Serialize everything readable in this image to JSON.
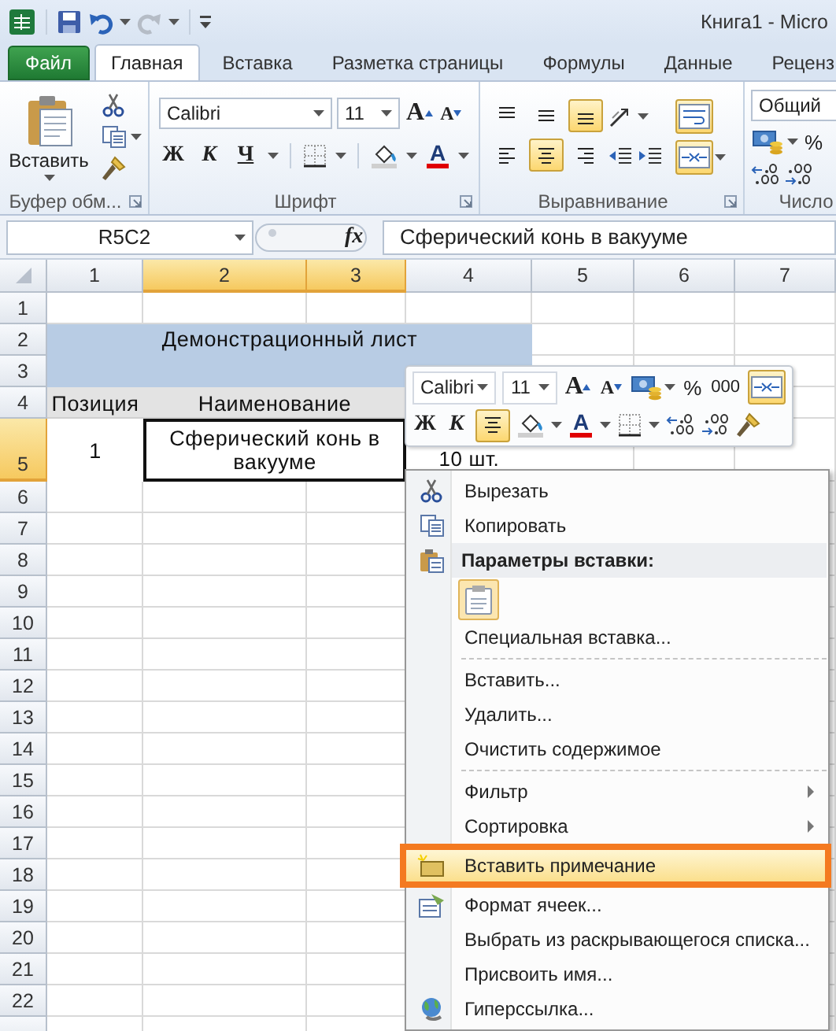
{
  "window": {
    "title": "Книга1 - Micro"
  },
  "tabs": [
    {
      "label": "Файл",
      "kind": "file",
      "selected": false
    },
    {
      "label": "Главная",
      "kind": "tab",
      "selected": true
    },
    {
      "label": "Вставка",
      "kind": "tab",
      "selected": false
    },
    {
      "label": "Разметка страницы",
      "kind": "tab",
      "selected": false
    },
    {
      "label": "Формулы",
      "kind": "tab",
      "selected": false
    },
    {
      "label": "Данные",
      "kind": "tab",
      "selected": false
    },
    {
      "label": "Реценз",
      "kind": "tab",
      "selected": false
    }
  ],
  "ribbon": {
    "clipboard": {
      "paste": "Вставить",
      "label": "Буфер обм..."
    },
    "font": {
      "name": "Calibri",
      "size": "11",
      "grow": "A",
      "shrink": "A",
      "bold": "Ж",
      "italic": "К",
      "underline": "Ч",
      "text_color_label": "A",
      "label": "Шрифт"
    },
    "alignment": {
      "vertical": [
        {
          "selected": false
        },
        {
          "selected": false
        },
        {
          "selected": true
        }
      ],
      "horizontal": [
        {
          "selected": false
        },
        {
          "selected": true
        },
        {
          "selected": false
        }
      ],
      "wrap": {
        "on": true
      },
      "merge": {
        "on": true
      },
      "label": "Выравнивание"
    },
    "number": {
      "format": "Общий",
      "percent": "%",
      "label": "Число"
    }
  },
  "formula_bar": {
    "name_box": "R5C2",
    "function_label": "fx",
    "content": "Сферический конь в вакууме"
  },
  "sheet": {
    "columns": [
      {
        "label": "1",
        "selected": false
      },
      {
        "label": "2",
        "selected": true
      },
      {
        "label": "3",
        "selected": true
      },
      {
        "label": "4",
        "selected": false
      },
      {
        "label": "5",
        "selected": false
      },
      {
        "label": "6",
        "selected": false
      },
      {
        "label": "7",
        "selected": false
      }
    ],
    "rows": [
      {
        "label": "1",
        "selected": false
      },
      {
        "label": "2",
        "selected": false
      },
      {
        "label": "3",
        "selected": false
      },
      {
        "label": "4",
        "selected": false
      },
      {
        "label": "5",
        "selected": true
      },
      {
        "label": "6",
        "selected": false
      },
      {
        "label": "7",
        "selected": false
      },
      {
        "label": "8",
        "selected": false
      },
      {
        "label": "9",
        "selected": false
      },
      {
        "label": "10",
        "selected": false
      },
      {
        "label": "11",
        "selected": false
      },
      {
        "label": "12",
        "selected": false
      },
      {
        "label": "13",
        "selected": false
      },
      {
        "label": "14",
        "selected": false
      },
      {
        "label": "15",
        "selected": false
      },
      {
        "label": "16",
        "selected": false
      },
      {
        "label": "17",
        "selected": false
      },
      {
        "label": "18",
        "selected": false
      },
      {
        "label": "19",
        "selected": false
      },
      {
        "label": "20",
        "selected": false
      },
      {
        "label": "21",
        "selected": false
      },
      {
        "label": "22",
        "selected": false
      }
    ],
    "title": "Демонстрационный лист",
    "headers": [
      "Позиция",
      "Наименование"
    ],
    "data": [
      {
        "text": "1",
        "selected": false
      },
      {
        "text": "Сферический конь в вакууме",
        "selected": true
      },
      {
        "text": "10 шт.",
        "selected": false
      }
    ]
  },
  "mini_toolbar": {
    "font": "Calibri",
    "size": "11",
    "grow": "A",
    "shrink": "A",
    "percent": "%",
    "thousands": "000",
    "merge": {
      "on": true
    },
    "bold": "Ж",
    "italic": "К",
    "align_center": {
      "on": true
    },
    "text_color_label": "A"
  },
  "context_menu": [
    {
      "kind": "command",
      "label": "Вырезать",
      "submenu": false,
      "highlighted": false
    },
    {
      "kind": "command",
      "label": "Копировать",
      "submenu": false,
      "highlighted": false
    },
    {
      "kind": "header",
      "label": "Параметры вставки:"
    },
    {
      "kind": "paste_options"
    },
    {
      "kind": "command",
      "label": "Специальная вставка...",
      "submenu": false,
      "highlighted": false
    },
    {
      "kind": "separator"
    },
    {
      "kind": "command",
      "label": "Вставить...",
      "submenu": false,
      "highlighted": false
    },
    {
      "kind": "command",
      "label": "Удалить...",
      "submenu": false,
      "highlighted": false
    },
    {
      "kind": "command",
      "label": "Очистить содержимое",
      "submenu": false,
      "highlighted": false
    },
    {
      "kind": "separator"
    },
    {
      "kind": "command",
      "label": "Фильтр",
      "submenu": true,
      "highlighted": false
    },
    {
      "kind": "command",
      "label": "Сортировка",
      "submenu": true,
      "highlighted": false
    },
    {
      "kind": "command",
      "label": "Вставить примечание",
      "submenu": false,
      "highlighted": true
    },
    {
      "kind": "command",
      "label": "Формат ячеек...",
      "submenu": false,
      "highlighted": false
    },
    {
      "kind": "command",
      "label": "Выбрать из раскрывающегося списка...",
      "submenu": false,
      "highlighted": false
    },
    {
      "kind": "command",
      "label": "Присвоить имя...",
      "submenu": false,
      "highlighted": false
    },
    {
      "kind": "command",
      "label": "Гиперссылка...",
      "submenu": false,
      "highlighted": false
    }
  ]
}
